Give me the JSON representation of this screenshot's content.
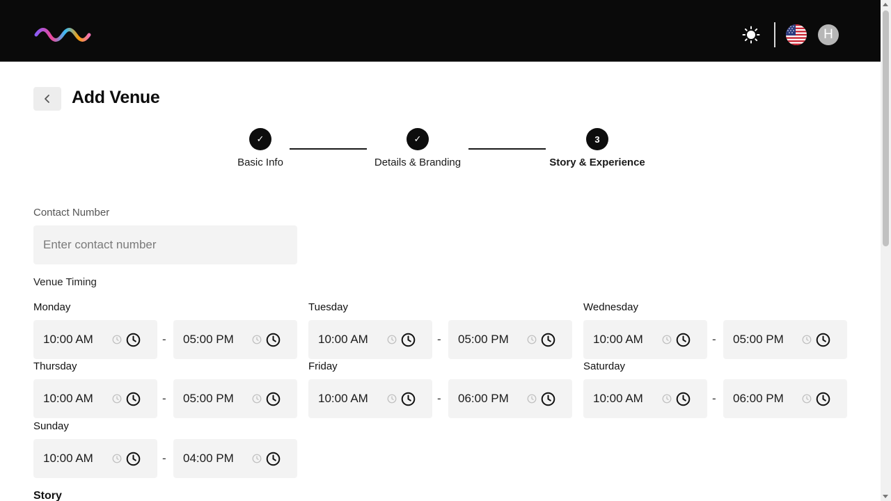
{
  "header": {
    "avatar_initial": "H",
    "logo_icon": "wave-logo",
    "theme_icon": "sun-icon",
    "language_icon": "us-flag-icon"
  },
  "page": {
    "title": "Add Venue",
    "back_icon": "chevron-left-icon"
  },
  "stepper": {
    "steps": [
      {
        "label": "Basic Info",
        "state": "done",
        "marker": "✓"
      },
      {
        "label": "Details & Branding",
        "state": "done",
        "marker": "✓"
      },
      {
        "label": "Story & Experience",
        "state": "active",
        "marker": "3"
      }
    ]
  },
  "contact": {
    "label": "Contact Number",
    "placeholder": "Enter contact number",
    "value": ""
  },
  "timing": {
    "label": "Venue Timing",
    "separator": "-",
    "days": [
      {
        "day": "Monday",
        "open": "10:00 AM",
        "close": "05:00 PM"
      },
      {
        "day": "Tuesday",
        "open": "10:00 AM",
        "close": "05:00 PM"
      },
      {
        "day": "Wednesday",
        "open": "10:00 AM",
        "close": "05:00 PM"
      },
      {
        "day": "Thursday",
        "open": "10:00 AM",
        "close": "05:00 PM"
      },
      {
        "day": "Friday",
        "open": "10:00 AM",
        "close": "06:00 PM"
      },
      {
        "day": "Saturday",
        "open": "10:00 AM",
        "close": "06:00 PM"
      },
      {
        "day": "Sunday",
        "open": "10:00 AM",
        "close": "04:00 PM"
      }
    ]
  },
  "story": {
    "heading": "Story"
  }
}
